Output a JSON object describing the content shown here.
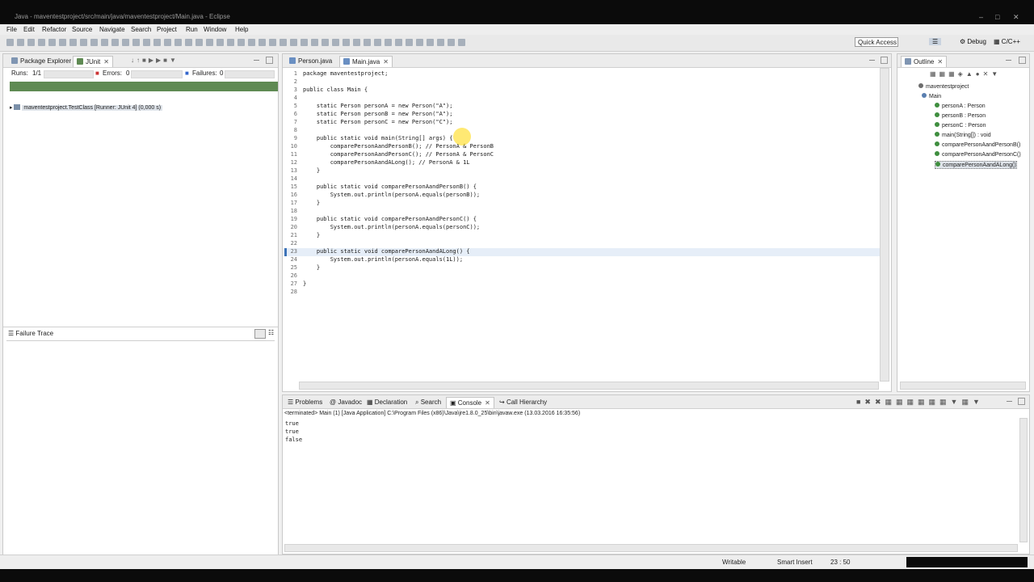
{
  "window": {
    "title": "Java - maventestproject/src/main/java/maventestproject/Main.java - Eclipse"
  },
  "menu": [
    "File",
    "Edit",
    "Refactor",
    "Source",
    "Navigate",
    "Search",
    "Project",
    "Run",
    "Window",
    "Help"
  ],
  "toolbar": {
    "quick_access": "Quick Access",
    "perspective_debug": "Debug",
    "perspective_cpp": "C/C++"
  },
  "left_panel": {
    "tabs": [
      "Package Explorer",
      "JUnit"
    ],
    "runs_label": "Runs:",
    "runs_value": "1/1",
    "errors_label": "Errors:",
    "errors_value": "0",
    "failures_label": "Failures:",
    "failures_value": "0",
    "tree_item": "maventestproject.TestClass [Runner: JUnit 4] (0,000 s)",
    "failure_trace": "Failure Trace"
  },
  "editor": {
    "tabs": [
      "Person.java",
      "Main.java"
    ],
    "lines": [
      {
        "n": "1",
        "t": "package maventestproject;"
      },
      {
        "n": "2",
        "t": ""
      },
      {
        "n": "3",
        "t": "public class Main {"
      },
      {
        "n": "4",
        "t": ""
      },
      {
        "n": "5",
        "t": "    static Person personA = new Person(\"A\");"
      },
      {
        "n": "6",
        "t": "    static Person personB = new Person(\"A\");"
      },
      {
        "n": "7",
        "t": "    static Person personC = new Person(\"C\");"
      },
      {
        "n": "8",
        "t": ""
      },
      {
        "n": "9",
        "t": "    public static void main(String[] args) {"
      },
      {
        "n": "10",
        "t": "        comparePersonAandPersonB(); // PersonA & PersonB"
      },
      {
        "n": "11",
        "t": "        comparePersonAandPersonC(); // PersonA & PersonC"
      },
      {
        "n": "12",
        "t": "        comparePersonAandALong(); // PersonA & 1L"
      },
      {
        "n": "13",
        "t": "    }"
      },
      {
        "n": "14",
        "t": ""
      },
      {
        "n": "15",
        "t": "    public static void comparePersonAandPersonB() {"
      },
      {
        "n": "16",
        "t": "        System.out.println(personA.equals(personB));"
      },
      {
        "n": "17",
        "t": "    }"
      },
      {
        "n": "18",
        "t": ""
      },
      {
        "n": "19",
        "t": "    public static void comparePersonAandPersonC() {"
      },
      {
        "n": "20",
        "t": "        System.out.println(personA.equals(personC));"
      },
      {
        "n": "21",
        "t": "    }"
      },
      {
        "n": "22",
        "t": ""
      },
      {
        "n": "23",
        "t": "    public static void comparePersonAandALong() {"
      },
      {
        "n": "24",
        "t": "        System.out.println(personA.equals(1L));"
      },
      {
        "n": "25",
        "t": "    }"
      },
      {
        "n": "26",
        "t": ""
      },
      {
        "n": "27",
        "t": "}"
      },
      {
        "n": "28",
        "t": ""
      }
    ]
  },
  "outline": {
    "tab": "Outline",
    "items": [
      "maventestproject",
      "Main",
      "personA : Person",
      "personB : Person",
      "personC : Person",
      "main(String[]) : void",
      "comparePersonAandPersonB()",
      "comparePersonAandPersonC()",
      "comparePersonAandALong()"
    ]
  },
  "bottom_panel": {
    "tabs": [
      "Problems",
      "Javadoc",
      "Declaration",
      "Search",
      "Console",
      "Call Hierarchy"
    ],
    "terminated": "<terminated> Main (1) [Java Application] C:\\Program Files (x86)\\Java\\jre1.8.0_25\\bin\\javaw.exe (13.03.2016 16:35:56)",
    "output": [
      "true",
      "true",
      "false"
    ]
  },
  "statusbar": {
    "writable": "Writable",
    "insert": "Smart Insert",
    "position": "23 : 50"
  },
  "colors": {
    "junit_bar": "#5f8a53",
    "highlight": "#ffd700",
    "current_line": "#e6eef8"
  }
}
